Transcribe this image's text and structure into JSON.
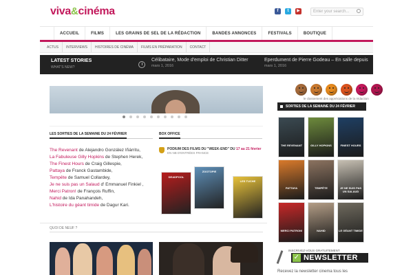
{
  "header": {
    "logo_part1": "viva",
    "logo_amp": "&",
    "logo_part2": "cinéma",
    "social": [
      {
        "icon": "facebook-icon",
        "glyph": "f",
        "color": "#3b5998"
      },
      {
        "icon": "twitter-icon",
        "glyph": "t",
        "color": "#29a9e1"
      },
      {
        "icon": "youtube-icon",
        "glyph": "▶",
        "color": "#c4302b"
      }
    ],
    "search_placeholder": "Enter your search..."
  },
  "nav": {
    "items": [
      "Accueil",
      "Films",
      "Les grains de sel de la rédaction",
      "Bandes annonces",
      "Festivals",
      "Boutique"
    ]
  },
  "subnav": {
    "items": [
      "Actus",
      "Interviews",
      "Histoires de cinéma",
      "Films en préparation",
      "Contact"
    ]
  },
  "latest": {
    "title": "Latest Stories",
    "subtitle": "What's new?",
    "stories": [
      {
        "title": "Célibataire, Mode d'emploi de Christian Ditter",
        "date": "mars 1, 2016"
      },
      {
        "title": "Eperdument de Pierre Godeau – En salle depuis",
        "date": "mars 1, 2016"
      }
    ]
  },
  "sorties": {
    "title": "Les sorties de la semaine du 24 février",
    "films": [
      {
        "title": "The Revenant",
        "rest": " de Alejandro González Iñárritu,"
      },
      {
        "title": "La Fabuleuse Gilly Hopkins",
        "rest": " de Stephen Herek,"
      },
      {
        "title": "The Finest Hours",
        "rest": " de Craig Gillespie,"
      },
      {
        "title": "Pattaya",
        "rest": " de Franck Gastambide,"
      },
      {
        "title": "Tempête",
        "rest": " de Samuel Collardey,"
      },
      {
        "title": "Je ne suis pas un Salaud",
        "rest": " d' Emmanuel Finkiel ,"
      },
      {
        "title": "Merci Patron!",
        "rest": " de François Ruffin,"
      },
      {
        "title": "Nahid",
        "rest": " de Ida Panahandeh,"
      },
      {
        "title": "L'histoire du géant timide",
        "rest": " de Dagur Kari."
      }
    ]
  },
  "box_office": {
    "title": "Box Office",
    "podium_text": "PODIUM DES FILMS DU \"WEEK-END\" DU",
    "podium_dates": "17 au 21 février",
    "podium_sub": "EN NB D'ENTRÉES FRANCE",
    "posters": [
      {
        "name": "deadpool-poster",
        "label": "Deadpool",
        "color": "#b71c1c"
      },
      {
        "name": "zootopia-poster",
        "label": "Zootopie",
        "color": "#5e8fb8"
      },
      {
        "name": "tuche-poster",
        "label": "Les Tuche",
        "color": "#e8c23a"
      }
    ]
  },
  "quoi_de_neuf": "Quoi de neuf ?",
  "sidebar": {
    "smileys": [
      {
        "color": "#a56a3a"
      },
      {
        "color": "#c7782f"
      },
      {
        "color": "#e58a1f"
      },
      {
        "color": "#d9531e"
      },
      {
        "color": "#c2185b"
      },
      {
        "color": "#b0164f"
      }
    ],
    "smiley_caption": "le classement des appréciations de la rédaction",
    "weekly_title": "Sorties de la semaine du 24 février",
    "posters": [
      {
        "name": "the-revenant-poster",
        "label": "The Revenant",
        "color": "#3b4a52"
      },
      {
        "name": "gilly-hopkins-poster",
        "label": "Gilly Hopkins",
        "color": "#6d8a3c"
      },
      {
        "name": "finest-hours-poster",
        "label": "Finest Hours",
        "color": "#1f3f63"
      },
      {
        "name": "pattaya-poster",
        "label": "Pattaya",
        "color": "#d97a2b"
      },
      {
        "name": "tempete-poster",
        "label": "Tempête",
        "color": "#8c7360"
      },
      {
        "name": "salaud-poster",
        "label": "Je ne suis pas un salaud",
        "color": "#c7c0b3"
      },
      {
        "name": "merci-patron-poster",
        "label": "Merci Patron!",
        "color": "#c62828"
      },
      {
        "name": "nahid-poster",
        "label": "Nahid",
        "color": "#b39d86"
      },
      {
        "name": "geant-timide-poster",
        "label": "Le géant timide",
        "color": "#6f6a5e"
      }
    ],
    "newsletter_small": "Inscrivez-vous gratuitement",
    "newsletter_big": "NEWSLETTER",
    "newsletter_text": "Recevez la newsletter cinema tous les"
  }
}
